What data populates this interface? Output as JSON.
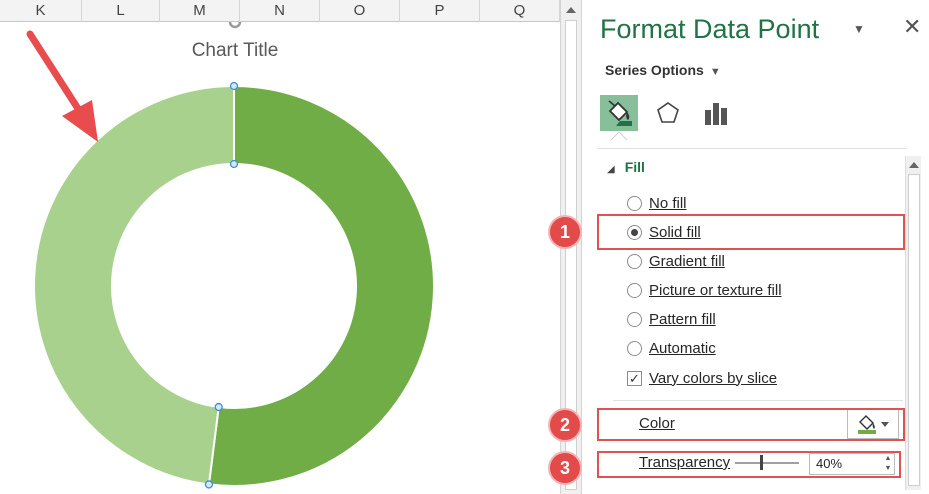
{
  "sheet": {
    "columns": [
      "K",
      "L",
      "M",
      "N",
      "O",
      "P",
      "Q"
    ]
  },
  "chart": {
    "title": "Chart Title"
  },
  "chart_data": {
    "type": "pie",
    "variant": "doughnut",
    "title": "Chart Title",
    "values": [
      52,
      48
    ],
    "colors": [
      "#70ad47",
      "#a9d18e"
    ],
    "selected_point_index": 1
  },
  "pane": {
    "title": "Format Data Point",
    "series_options_label": "Series Options",
    "tabs": [
      {
        "name": "fill-line",
        "icon": "paint-bucket-icon",
        "active": true
      },
      {
        "name": "effects",
        "icon": "pentagon-icon",
        "active": false
      },
      {
        "name": "series-options",
        "icon": "bar-chart-icon",
        "active": false
      }
    ],
    "fill_section": {
      "label": "Fill",
      "options": [
        {
          "label": "No fill",
          "selected": false
        },
        {
          "label": "Solid fill",
          "selected": true
        },
        {
          "label": "Gradient fill",
          "selected": false
        },
        {
          "label": "Picture or texture fill",
          "selected": false
        },
        {
          "label": "Pattern fill",
          "selected": false
        },
        {
          "label": "Automatic",
          "selected": false
        }
      ],
      "vary_colors": {
        "label": "Vary colors by slice",
        "checked": true
      },
      "color_label": "Color",
      "color_swatch": "#70ad47",
      "transparency_label": "Transparency",
      "transparency_value": "40%",
      "transparency_fraction": 0.4
    }
  },
  "callouts": [
    "1",
    "2",
    "3"
  ],
  "colors": {
    "accent": "#217346",
    "callout": "#e34a4a",
    "arrow": "#e84c4c"
  }
}
